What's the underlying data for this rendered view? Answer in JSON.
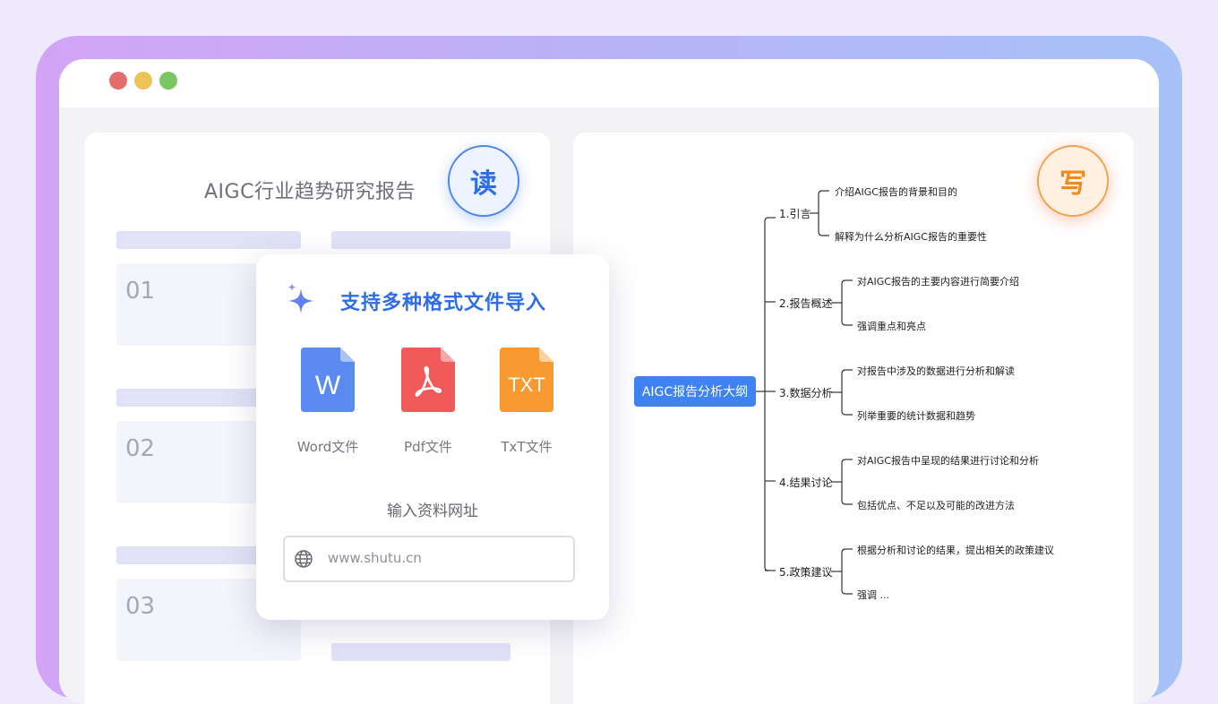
{
  "window": {
    "controls": [
      "close",
      "minimize",
      "maximize"
    ]
  },
  "reader": {
    "title": "AIGC行业趋势研究报告",
    "badge": "读",
    "sections": [
      "01",
      "02",
      "03"
    ]
  },
  "import": {
    "title": "支持多种格式文件导入",
    "files": [
      {
        "icon": "word-file-icon",
        "glyph": "W",
        "label": "Word文件",
        "color": "#5b8af0"
      },
      {
        "icon": "pdf-file-icon",
        "glyph": "",
        "label": "Pdf文件",
        "color": "#f25a5a"
      },
      {
        "icon": "txt-file-icon",
        "glyph": "TXT",
        "label": "TxT文件",
        "color": "#f89a30"
      }
    ],
    "url_title": "输入资料网址",
    "url_value": "www.shutu.cn"
  },
  "writer": {
    "badge": "写",
    "mindmap": {
      "root": "AIGC报告分析大纲",
      "branches": [
        {
          "label": "1.引言",
          "leaves": [
            "介绍AIGC报告的背景和目的",
            "解释为什么分析AIGC报告的重要性"
          ]
        },
        {
          "label": "2.报告概述",
          "leaves": [
            "对AIGC报告的主要内容进行简要介绍",
            "强调重点和亮点"
          ]
        },
        {
          "label": "3.数据分析",
          "leaves": [
            "对报告中涉及的数据进行分析和解读",
            "列举重要的统计数据和趋势"
          ]
        },
        {
          "label": "4.结果讨论",
          "leaves": [
            "对AIGC报告中呈现的结果进行讨论和分析",
            "包括优点、不足以及可能的改进方法"
          ]
        },
        {
          "label": "5.政策建议",
          "leaves": [
            "根据分析和讨论的结果，提出相关的政策建议",
            "强调  ..."
          ]
        }
      ]
    }
  },
  "colors": {
    "accent_blue": "#2f6de8",
    "accent_orange": "#f08a1e",
    "mindmap_root": "#3f83f2"
  }
}
